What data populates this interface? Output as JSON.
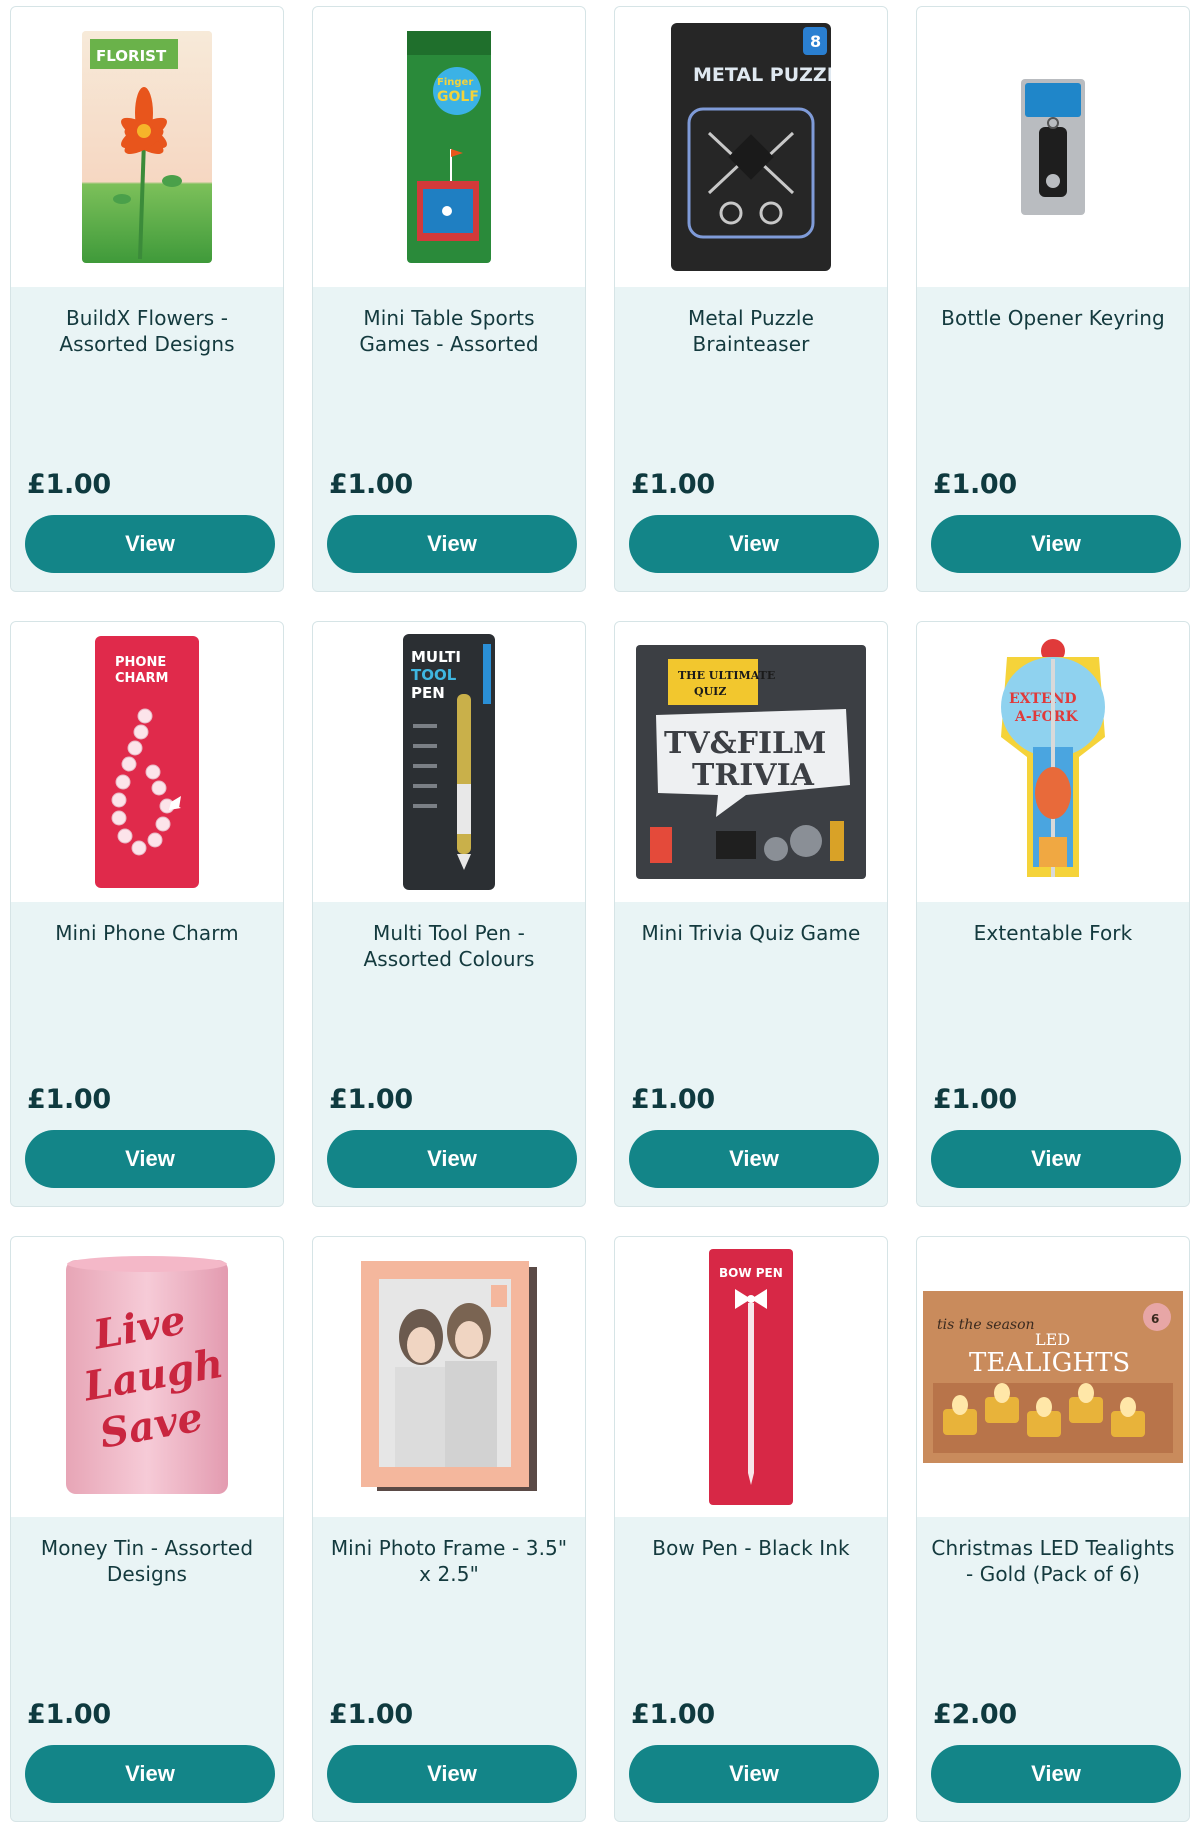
{
  "products": [
    {
      "title": "BuildX Flowers - Assorted Designs",
      "price": "£1.00",
      "button": "View",
      "icon": "florist-kit-image",
      "pack_text": "FLORIST"
    },
    {
      "title": "Mini Table Sports Games - Assorted",
      "price": "£1.00",
      "button": "View",
      "icon": "finger-golf-image",
      "pack_text": "Finger GOLF"
    },
    {
      "title": "Metal Puzzle Brainteaser",
      "price": "£1.00",
      "button": "View",
      "icon": "metal-puzzle-image",
      "pack_text": "METAL PUZZLE"
    },
    {
      "title": "Bottle Opener Keyring",
      "price": "£1.00",
      "button": "View",
      "icon": "bottle-opener-image"
    },
    {
      "title": "Mini Phone Charm",
      "price": "£1.00",
      "button": "View",
      "icon": "phone-charm-image",
      "pack_text": "PHONE CHARM"
    },
    {
      "title": "Multi Tool Pen - Assorted Colours",
      "price": "£1.00",
      "button": "View",
      "icon": "multi-tool-pen-image",
      "pack_text": "MULTI TOOL PEN"
    },
    {
      "title": "Mini Trivia Quiz Game",
      "price": "£1.00",
      "button": "View",
      "icon": "trivia-game-image",
      "pack_text": "TV & FILM TRIVIA"
    },
    {
      "title": "Extentable Fork",
      "price": "£1.00",
      "button": "View",
      "icon": "extendable-fork-image",
      "pack_text": "EXTEND A-FORK"
    },
    {
      "title": "Money Tin - Assorted Designs",
      "price": "£1.00",
      "button": "View",
      "icon": "money-tin-image",
      "pack_text": "Live Laugh Save"
    },
    {
      "title": "Mini Photo Frame - 3.5\" x 2.5\"",
      "price": "£1.00",
      "button": "View",
      "icon": "photo-frame-image"
    },
    {
      "title": "Bow Pen - Black Ink",
      "price": "£1.00",
      "button": "View",
      "icon": "bow-pen-image",
      "pack_text": "BOW PEN"
    },
    {
      "title": "Christmas LED Tealights - Gold (Pack of 6)",
      "price": "£2.00",
      "button": "View",
      "icon": "led-tealights-image",
      "pack_text": "LED TEALIGHTS"
    }
  ],
  "colors": {
    "accent": "#138588",
    "card_background": "#e9f4f5",
    "price_text": "#0f3a3f"
  }
}
